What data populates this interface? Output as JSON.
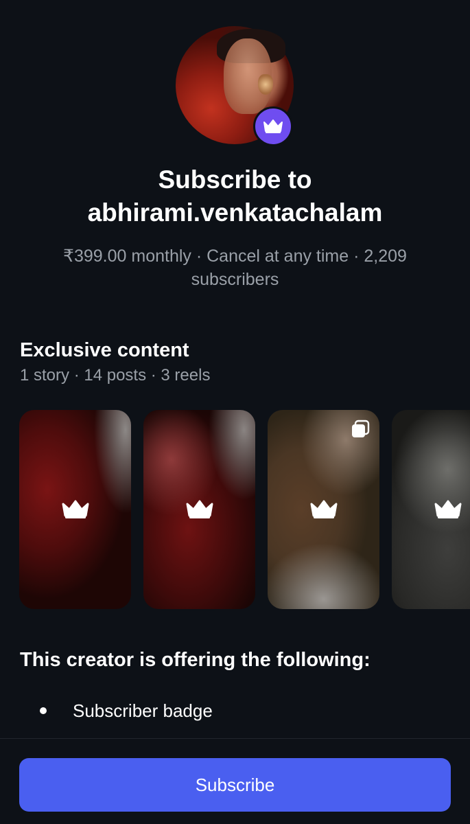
{
  "header": {
    "title_line1": "Subscribe to",
    "title_line2": "abhirami.venkatachalam",
    "meta": "₹399.00 monthly · Cancel at any time · 2,209 subscribers"
  },
  "avatar": {
    "badge_icon": "crown-icon",
    "badge_color": "#6f4df0"
  },
  "exclusive": {
    "title": "Exclusive content",
    "subtitle": "1 story · 14 posts · 3 reels",
    "tiles": [
      {
        "icon": "crown-icon",
        "multi": false
      },
      {
        "icon": "crown-icon",
        "multi": false
      },
      {
        "icon": "crown-icon",
        "multi": true,
        "multi_icon": "multiple-posts-icon"
      },
      {
        "icon": "crown-icon",
        "multi": false
      }
    ]
  },
  "offering": {
    "title": "This creator is offering the following:",
    "items": [
      "Subscriber badge"
    ]
  },
  "cta": {
    "label": "Subscribe",
    "color": "#4a5ff0"
  }
}
